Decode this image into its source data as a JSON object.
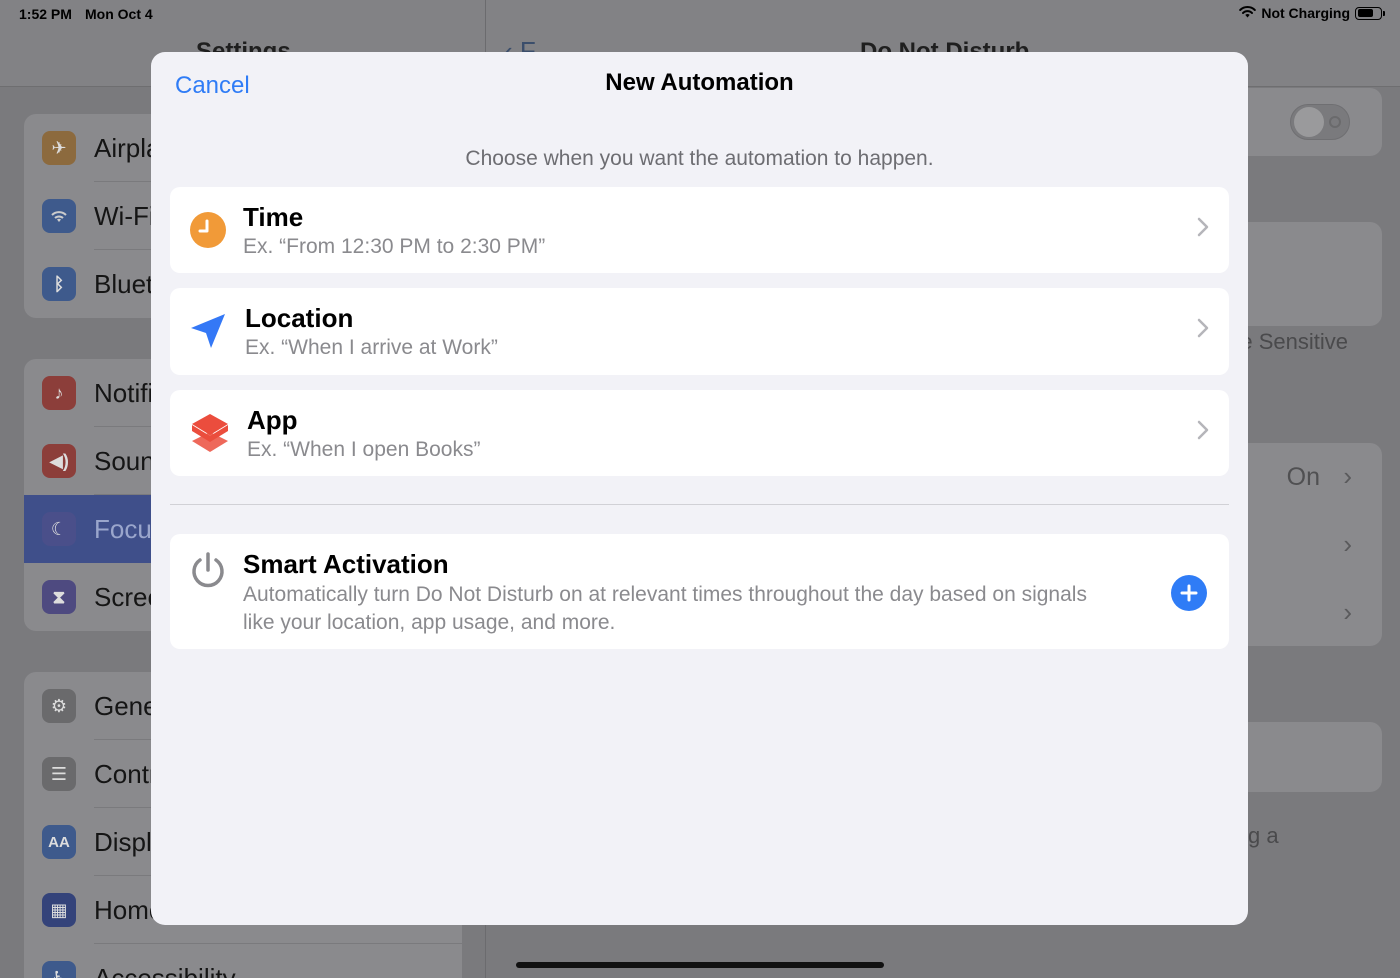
{
  "status_bar": {
    "time": "1:52 PM",
    "date": "Mon Oct 4",
    "charging": "Not Charging",
    "battery_level": 0.7
  },
  "background": {
    "left_title": "Settings",
    "right_title": "Do Not Disturb",
    "back_label": "F",
    "sidebar_groups": [
      [
        {
          "label": "Airplane Mode",
          "icon": "airplane-icon",
          "color": "#f09a37"
        },
        {
          "label": "Wi-Fi",
          "icon": "wifi-icon",
          "color": "#3478f6"
        },
        {
          "label": "Bluetooth",
          "icon": "bluetooth-icon",
          "color": "#3478f6"
        }
      ],
      [
        {
          "label": "Notifications",
          "icon": "bell-icon",
          "color": "#eb4d3d"
        },
        {
          "label": "Sounds",
          "icon": "speaker-icon",
          "color": "#eb4d3d"
        },
        {
          "label": "Focus",
          "icon": "moon-icon",
          "color": "#5856d6",
          "selected": true
        },
        {
          "label": "Screen Time",
          "icon": "hourglass-icon",
          "color": "#5856d6"
        }
      ],
      [
        {
          "label": "General",
          "icon": "gear-icon",
          "color": "#8e8e93"
        },
        {
          "label": "Control Center",
          "icon": "switches-icon",
          "color": "#8e8e93"
        },
        {
          "label": "Display & Brightness",
          "icon": "aa-icon",
          "color": "#3478f6"
        },
        {
          "label": "Home Screen & Dock",
          "icon": "grid-icon",
          "color": "#3478f6"
        },
        {
          "label": "Accessibility",
          "icon": "accessibility-icon",
          "color": "#3478f6"
        }
      ]
    ],
    "right_fragments": {
      "sensitive_text": "e Sensitive",
      "on_value": "On",
      "footer_fragment": "g a"
    }
  },
  "modal": {
    "cancel_label": "Cancel",
    "title": "New Automation",
    "subtitle": "Choose when you want the automation to happen.",
    "options": [
      {
        "title": "Time",
        "example": "Ex. “From 12:30 PM to 2:30 PM”",
        "icon": "clock-icon",
        "color": "#f19a38"
      },
      {
        "title": "Location",
        "example": "Ex. “When I arrive at Work”",
        "icon": "location-arrow-icon",
        "color": "#3478f6"
      },
      {
        "title": "App",
        "example": "Ex. “When I open Books”",
        "icon": "app-layers-icon",
        "color": "#eb4d3d"
      }
    ],
    "smart_activation": {
      "title": "Smart Activation",
      "description": "Automatically turn Do Not Disturb on at relevant times throughout the day based on signals like your location, app usage, and more.",
      "icon": "power-icon",
      "action_icon": "plus-icon"
    }
  },
  "colors": {
    "accent": "#2f7cf6",
    "modal_bg": "#f2f2f7",
    "card_bg": "#ffffff"
  }
}
